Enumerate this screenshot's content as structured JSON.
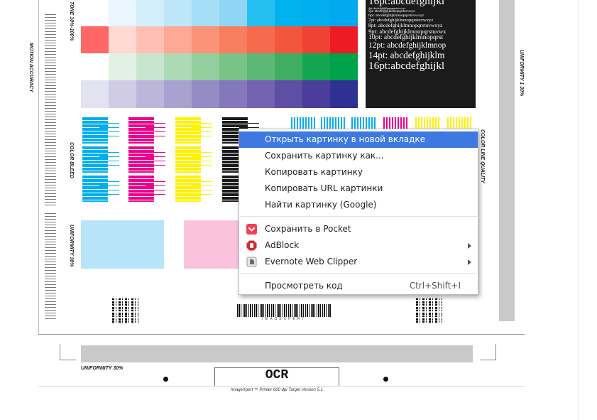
{
  "target": {
    "labels": {
      "tone": "TONE 10%-100%",
      "motion": "MOTION ACCURACY",
      "color_bleed": "COLOR BLEED",
      "uniformity_side": "UNIFORMITY 30%",
      "uniformity_bottom": "UNIFORMITY 30%",
      "color_line": "COLOR LINE QUALITY",
      "uniformity_right": "UNIFORMITY 1 30%",
      "ocr": "OCR",
      "barcode_caption": "IMAGEXPERT",
      "footer": "ImageXpert ™ Printer 600 dpi Target Version 5.1"
    },
    "font_sizes": [
      {
        "text": "16pt:abcdefghijkl",
        "size": 16
      },
      {
        "text": "4pt: abcdefghijklmnopqrstuvwxyz",
        "size": 4
      },
      {
        "text": "5pt: abcdefghijklmnopqrstuvwxyz",
        "size": 5
      },
      {
        "text": "6pt: abcdefghijklmnopqrstuvwxyz",
        "size": 6
      },
      {
        "text": "7pt: abcdefghijklmnopqrstuvwxyz",
        "size": 7
      },
      {
        "text": "8pt: abcdefghijklmnopqrstuvwxyz",
        "size": 8
      },
      {
        "text": "9pt: abcdefghijklmnopqrstuvwx",
        "size": 9
      },
      {
        "text": "10pt: abcdefghijklmnopqrst",
        "size": 10
      },
      {
        "text": "12pt: abcdefghijklmnop",
        "size": 12
      },
      {
        "text": "14pt: abcdefghijklm",
        "size": 14
      },
      {
        "text": "16pt:abcdefghijkl",
        "size": 16
      }
    ],
    "swatch_rows": [
      [
        "#ffffff",
        "#e9f6fd",
        "#d3eefb",
        "#bde6f9",
        "#a6def7",
        "#8fd6f5",
        "#26c0f0",
        "#00b3ee",
        "#00aeef",
        "#00a8ed"
      ],
      [
        "#ff6767",
        "#ffd9d2",
        "#ffc0b3",
        "#fda996",
        "#fb9379",
        "#f97d60",
        "#f56a4d",
        "#f2573e",
        "#ef4134",
        "#ed1c24"
      ],
      [
        "#ffffff",
        "#e3f1e5",
        "#c8e6cd",
        "#aed9b5",
        "#93ce9e",
        "#78c388",
        "#5cb874",
        "#3fae63",
        "#14a550",
        "#00a14b"
      ],
      [
        "#e3e2f1",
        "#d0cce6",
        "#bdb6db",
        "#aaa1d1",
        "#978bc6",
        "#8577bc",
        "#7463b2",
        "#5e4ea6",
        "#4a3d9b",
        "#2e3192"
      ]
    ]
  },
  "context_menu": {
    "items": [
      {
        "label": "Открыть картинку в новой вкладке"
      },
      {
        "label": "Сохранить картинку как..."
      },
      {
        "label": "Копировать картинку"
      },
      {
        "label": "Копировать URL картинки"
      },
      {
        "label": "Найти картинку (Google)"
      },
      {
        "label": "Сохранить в Pocket",
        "icon": "pocket-icon"
      },
      {
        "label": "AdBlock",
        "icon": "adblock-icon"
      },
      {
        "label": "Evernote Web Clipper",
        "icon": "evernote-icon"
      },
      {
        "label": "Просмотреть код",
        "shortcut": "Ctrl+Shift+I"
      }
    ],
    "highlight_color": "#3d79e0",
    "outline_color": "#d9252a"
  }
}
